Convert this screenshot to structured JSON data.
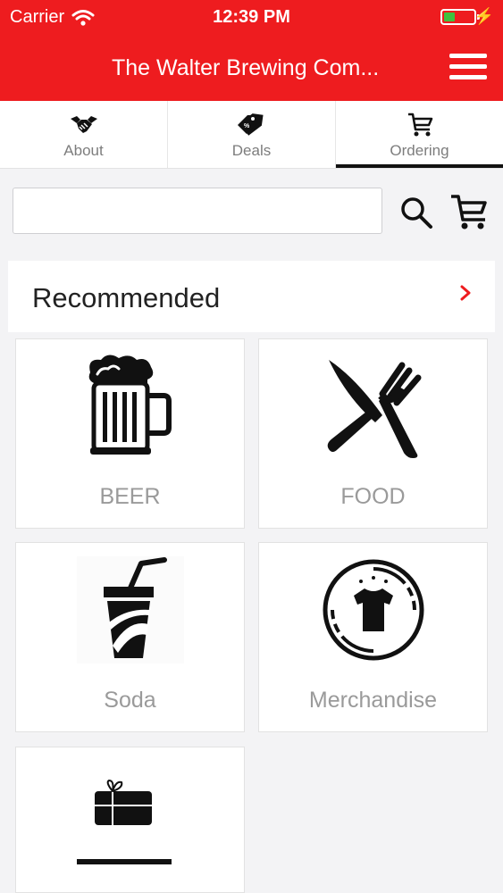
{
  "status_bar": {
    "carrier": "Carrier",
    "time": "12:39 PM",
    "battery_level": 0.35,
    "battery_color": "#3ec13e"
  },
  "header": {
    "title": "The Walter Brewing Com...",
    "background_color": "#ee1c1f",
    "menu_icon": "hamburger-icon"
  },
  "tabs": [
    {
      "label": "About",
      "icon": "handshake-icon",
      "active": false
    },
    {
      "label": "Deals",
      "icon": "price-tags-icon",
      "active": false
    },
    {
      "label": "Ordering",
      "icon": "shopping-cart-icon",
      "active": true
    }
  ],
  "search": {
    "value": "",
    "placeholder": "",
    "search_icon": "search-icon",
    "cart_icon": "shopping-cart-icon"
  },
  "recommended": {
    "title": "Recommended",
    "chevron_icon": "chevron-right-icon",
    "chevron_color": "#ee1c1f"
  },
  "categories": [
    {
      "label": "BEER",
      "icon": "beer-mug-icon"
    },
    {
      "label": "FOOD",
      "icon": "knife-fork-icon"
    },
    {
      "label": "Soda",
      "icon": "soda-cup-icon"
    },
    {
      "label": "Merchandise",
      "icon": "tshirt-badge-icon"
    },
    {
      "label": "",
      "icon": "gift-card-icon"
    }
  ]
}
